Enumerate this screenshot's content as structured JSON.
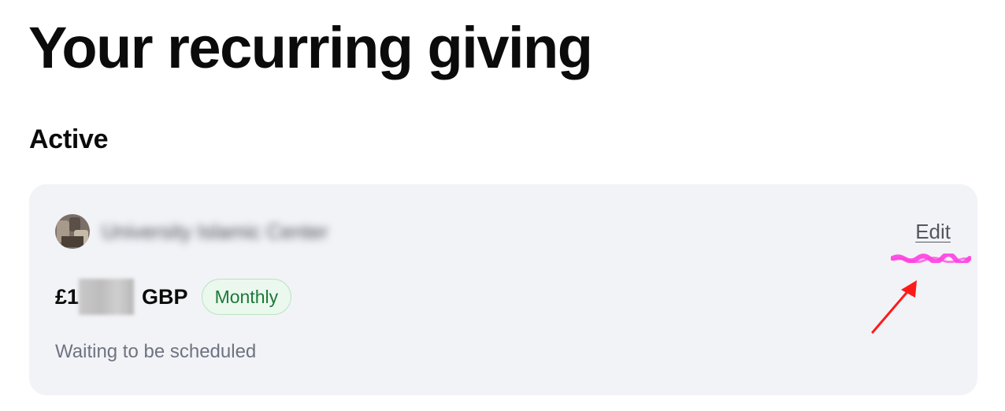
{
  "page": {
    "title": "Your recurring giving",
    "section_heading": "Active"
  },
  "donation_card": {
    "org_name": "University Islamic Center",
    "edit_label": "Edit",
    "amount_prefix": "£1",
    "amount_currency": "GBP",
    "frequency": "Monthly",
    "status": "Waiting to be scheduled"
  },
  "annotations": {
    "arrow_color": "#ff1a1a",
    "scribble_color": "#ff3ee0"
  },
  "colors": {
    "card_background": "#f2f3f7",
    "badge_text": "#1c7a37",
    "badge_background": "#ebf8ee",
    "status_text": "#6e7380"
  }
}
